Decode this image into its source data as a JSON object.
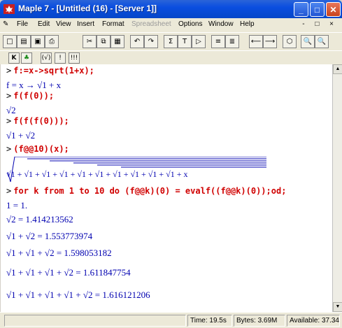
{
  "window": {
    "title": "Maple 7 - [Untitled (16) - [Server 1]]",
    "minimize": "_",
    "maximize": "□",
    "close": "✕",
    "icon": "maple-leaf-icon"
  },
  "menu": {
    "items": [
      {
        "label": "File"
      },
      {
        "label": "Edit"
      },
      {
        "label": "View"
      },
      {
        "label": "Insert"
      },
      {
        "label": "Format"
      },
      {
        "label": "Spreadsheet"
      },
      {
        "label": "Options"
      },
      {
        "label": "Window"
      },
      {
        "label": "Help"
      }
    ],
    "mdi_controls": "- □ ×"
  },
  "toolbar1": [
    "new",
    "open",
    "save",
    "print",
    "cut",
    "copy",
    "paste",
    "undo",
    "redo",
    "Σ",
    "T",
    "▷",
    "indent",
    "outdent",
    "⟵",
    "⟶",
    "stop",
    "zoom-in",
    "zoom-out"
  ],
  "toolbar2": [
    "K",
    "leaf",
    "(√)",
    "!",
    "!!!"
  ],
  "worksheet": {
    "prompt": ">",
    "lines": [
      {
        "type": "input",
        "text": "f:=x->sqrt(1+x);"
      },
      {
        "type": "output",
        "text": "f = x → √1 + x"
      },
      {
        "type": "input",
        "text": "f(f(0));"
      },
      {
        "type": "output",
        "text": "√2"
      },
      {
        "type": "input",
        "text": "f(f(f(0)));"
      },
      {
        "type": "output",
        "text": "√1 + √2"
      },
      {
        "type": "input",
        "text": "(f@@10)(x);"
      },
      {
        "type": "output",
        "text": "√1 + √1 + √1 + √1 + √1 + √1 + √1 + √1 + √1 + √1 + x"
      },
      {
        "type": "input",
        "text": "for k from 1 to 10 do (f@@k)(0) = evalf((f@@k)(0));od;"
      },
      {
        "type": "output",
        "text": "1 = 1."
      },
      {
        "type": "output",
        "text": "√2 = 1.414213562"
      },
      {
        "type": "output",
        "text": "√1 + √2 = 1.553773974"
      },
      {
        "type": "output",
        "text": "√1 + √1 + √2 = 1.598053182"
      },
      {
        "type": "output",
        "text": "√1 + √1 + √1 + √2 = 1.611847754"
      },
      {
        "type": "output",
        "text": "√1 + √1 + √1 + √1 + √2 = 1.616121206"
      }
    ]
  },
  "status": {
    "time": "Time: 19.5s",
    "bytes": "Bytes: 3.69M",
    "available": "Available: 37.34"
  },
  "colors": {
    "input": "#d00000",
    "output": "#0000b0",
    "titlebar": "#0a4ee0"
  }
}
